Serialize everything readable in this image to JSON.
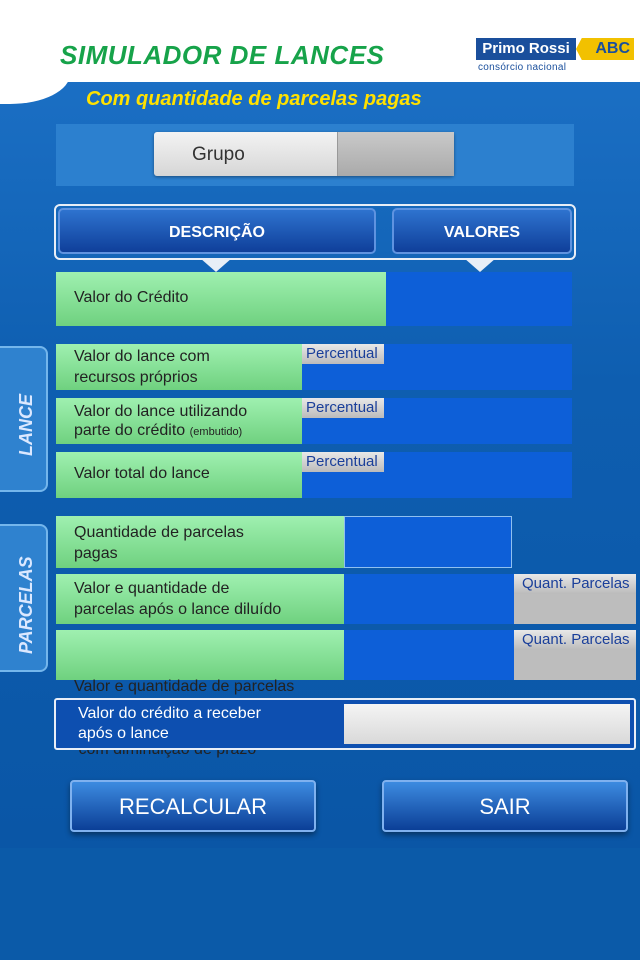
{
  "header": {
    "title": "SIMULADOR DE LANCES",
    "subtitle": "Com quantidade de parcelas pagas",
    "logo": {
      "name": "Primo Rossi",
      "abc": "ABC",
      "tagline": "consórcio nacional"
    }
  },
  "grupo": {
    "label": "Grupo"
  },
  "columns": {
    "descricao": "DESCRIÇÃO",
    "valores": "VALORES"
  },
  "rows": {
    "valor_credito": "Valor do  Crédito",
    "lance_proprios": [
      "Valor do lance com",
      "recursos próprios"
    ],
    "lance_credito": [
      "Valor do lance utilizando",
      "parte do crédito"
    ],
    "lance_credito_note": "(embutido)",
    "lance_total": "Valor total do lance",
    "parcelas_pagas": [
      "Quantidade de parcelas",
      "pagas"
    ],
    "parcelas_diluido": [
      "Valor e quantidade de",
      "parcelas após o lance diluído"
    ],
    "parcelas_prazo": [
      "Valor e quantidade de parcelas",
      " com diminuição de prazo"
    ]
  },
  "tags": {
    "percentual": "Percentual",
    "quant_parcelas": "Quant. Parcelas"
  },
  "groups": {
    "lance": "LANCE",
    "parcelas": "PARCELAS"
  },
  "final": {
    "label": [
      "Valor do crédito a receber",
      "após o lance"
    ]
  },
  "buttons": {
    "recalcular": "RECALCULAR",
    "sair": "SAIR"
  }
}
